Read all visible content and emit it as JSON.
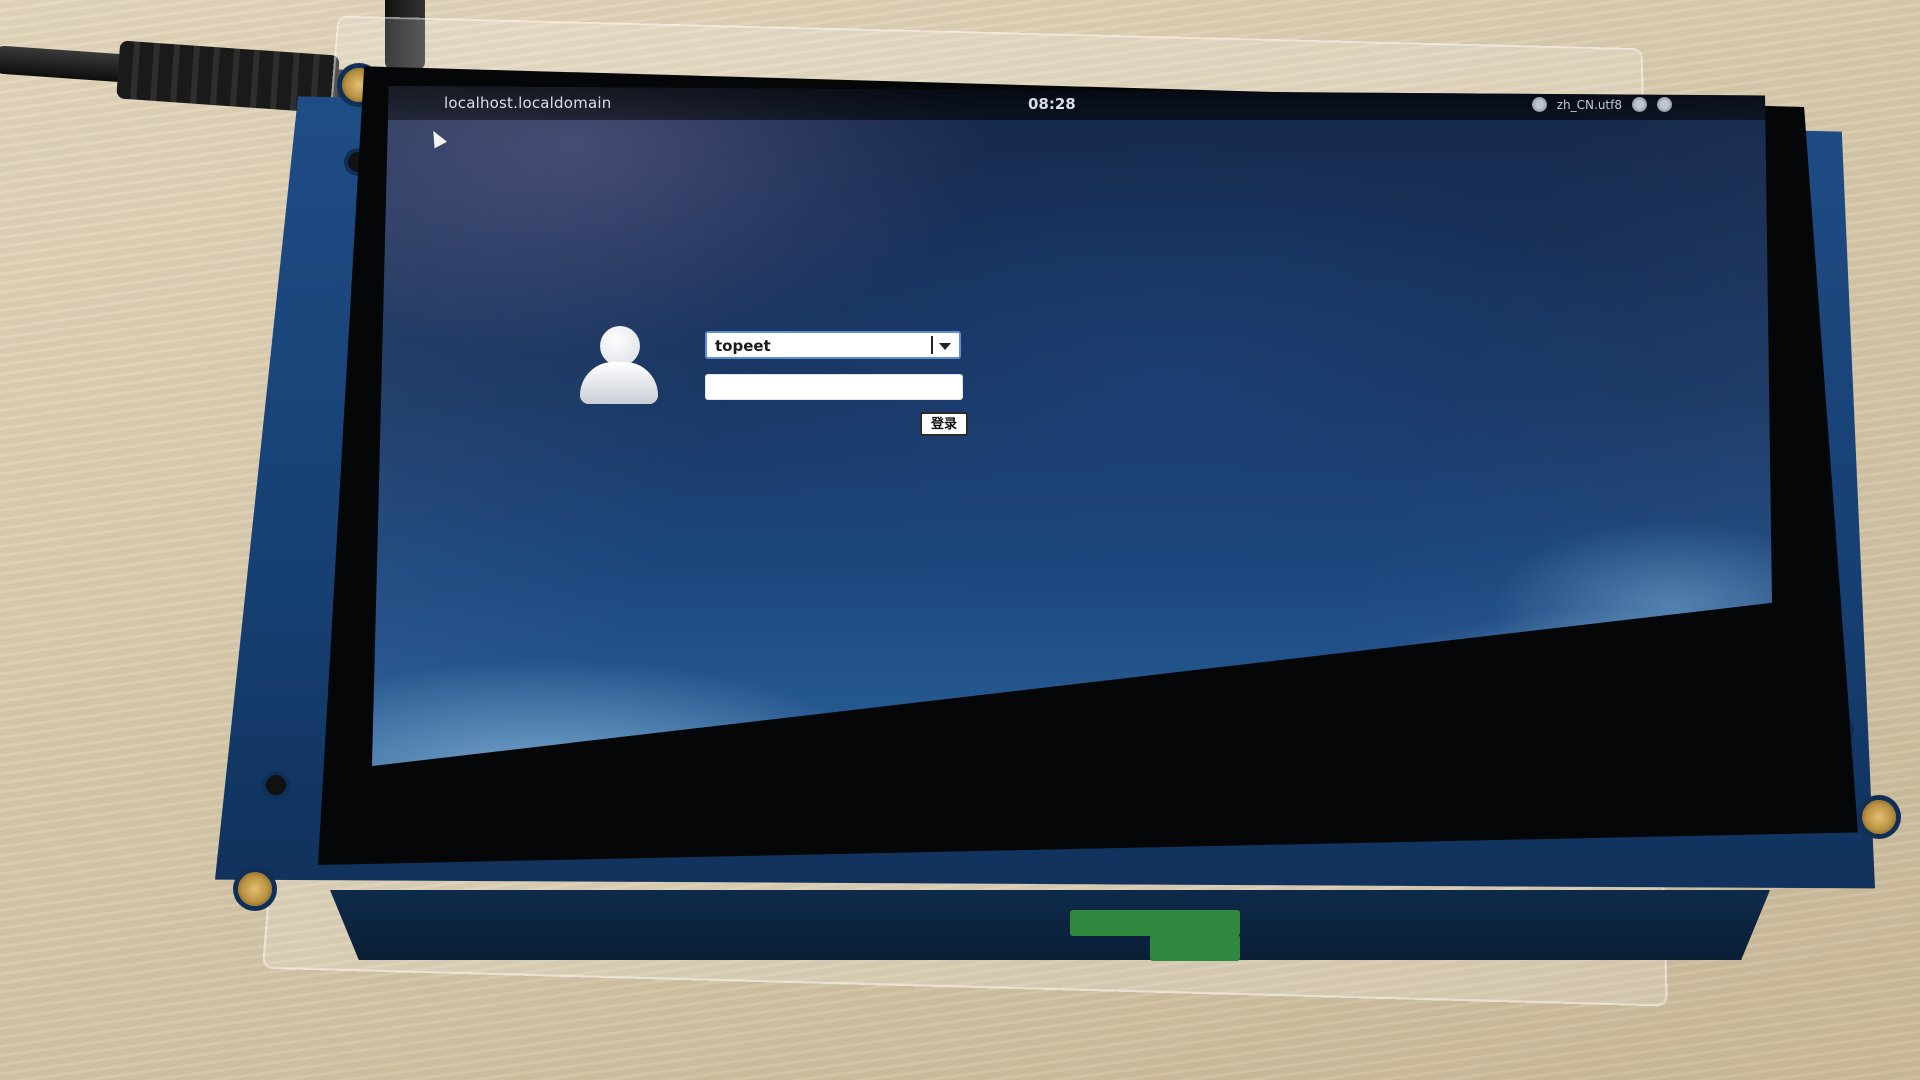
{
  "topbar": {
    "hostname": "localhost.localdomain",
    "clock": "08:28",
    "locale": "zh_CN.utf8"
  },
  "login": {
    "username": "topeet",
    "password_value": "",
    "login_label": "登录"
  },
  "icons": {
    "user": "avatar-icon",
    "dropdown": "chevron-down-icon",
    "tray": [
      "accessibility-icon",
      "keyboard-icon",
      "power-icon"
    ],
    "pointer": "mouse-cursor-icon"
  },
  "colors": {
    "wallpaper_dark": "#16284a",
    "wallpaper_light": "#2a5f97",
    "topbar": "#000000",
    "select_border": "#5f8fd0"
  }
}
